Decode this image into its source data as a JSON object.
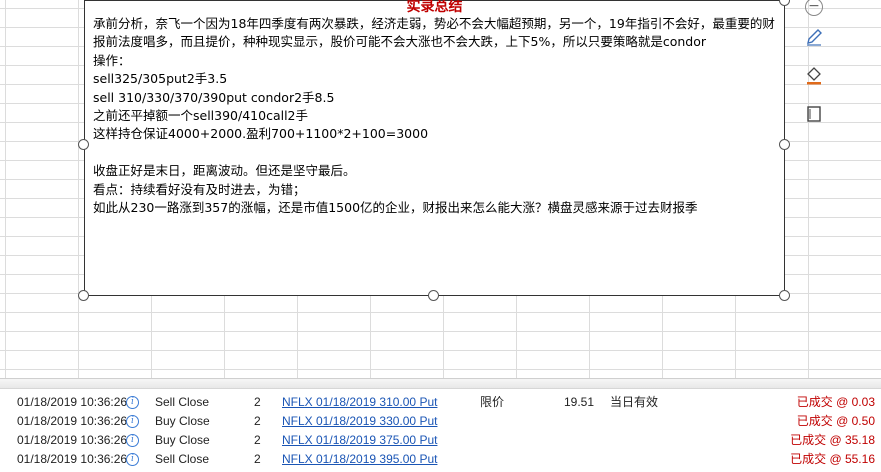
{
  "note": {
    "title": "实录总结",
    "lines": [
      "承前分析，奈飞一个因为18年四季度有两次暴跌，经济走弱，势必不会大幅超预期，另一个，19年指引不会好，最重要的财报前法度唱多，而且提价，种种现实显示，股价可能不会大涨也不会大跌，上下5%，所以只要策略就是condor",
      "操作：",
      "sell325/305put2手3.5",
      "sell 310/330/370/390put condor2手8.5",
      "之前还平掉额一个sell390/410call2手",
      "这样持仓保证4000+2000.盈利700+1100*2+100=3000",
      "",
      "收盘正好是末日，距离波动。但还是坚守最后。",
      "看点：持续看好没有及时进去，为错；",
      "如此从230一路涨到357的涨幅，还是市值1500亿的企业，财报出来怎么能大涨？横盘灵感来源于过去财报季"
    ]
  },
  "toolbar": {
    "minus_label": "−",
    "icons": [
      "minus-icon",
      "pen-icon",
      "fill-bucket-icon",
      "border-icon"
    ]
  },
  "colors": {
    "title_red": "#c00000",
    "status_red": "#c00000",
    "link_blue": "#1a55b5",
    "info_blue": "#3a7bd5"
  },
  "orders": [
    {
      "time": "01/18/2019 10:36:26",
      "action": "Sell Close",
      "qty": "2",
      "symbol": "NFLX 01/18/2019 310.00 Put",
      "type": "限价",
      "price": "19.51",
      "tif": "当日有效",
      "status": "已成交 @ 0.03"
    },
    {
      "time": "01/18/2019 10:36:26",
      "action": "Buy Close",
      "qty": "2",
      "symbol": "NFLX 01/18/2019 330.00 Put",
      "type": "",
      "price": "",
      "tif": "",
      "status": "已成交 @ 0.50"
    },
    {
      "time": "01/18/2019 10:36:26",
      "action": "Buy Close",
      "qty": "2",
      "symbol": "NFLX 01/18/2019 375.00 Put",
      "type": "",
      "price": "",
      "tif": "",
      "status": "已成交 @ 35.18"
    },
    {
      "time": "01/18/2019 10:36:26",
      "action": "Sell Close",
      "qty": "2",
      "symbol": "NFLX 01/18/2019 395.00 Put",
      "type": "",
      "price": "",
      "tif": "",
      "status": "已成交 @ 55.16"
    }
  ]
}
